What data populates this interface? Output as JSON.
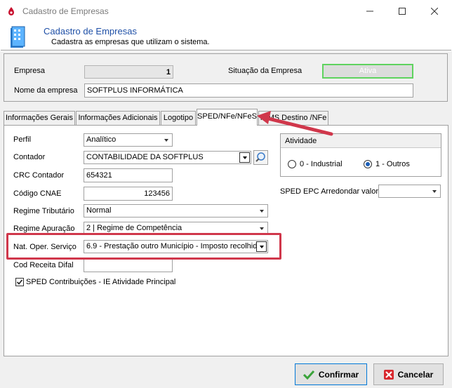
{
  "window": {
    "title": "Cadastro de Empresas"
  },
  "header": {
    "title": "Cadastro de Empresas",
    "subtitle": "Cadastra as empresas que utilizam o sistema."
  },
  "empresa": {
    "label_empresa": "Empresa",
    "empresa_value": "1",
    "label_situacao": "Situação da Empresa",
    "situacao_value": "Ativa",
    "label_nome": "Nome da empresa",
    "nome_value": "SOFTPLUS INFORMÁTICA"
  },
  "tabs": [
    {
      "label": "Informações Gerais"
    },
    {
      "label": "Informações Adicionais"
    },
    {
      "label": "Logotipo"
    },
    {
      "label": "SPED/NFe/NFeS"
    },
    {
      "label": "ICMS Destino /NFe"
    }
  ],
  "sped": {
    "perfil_label": "Perfil",
    "perfil_value": "Analítico",
    "contador_label": "Contador",
    "contador_value": "CONTABILIDADE DA SOFTPLUS",
    "crc_label": "CRC Contador",
    "crc_value": "654321",
    "cnae_label": "Código CNAE",
    "cnae_value": "123456",
    "regime_trib_label": "Regime Tributário",
    "regime_trib_value": "Normal",
    "regime_apur_label": "Regime Apuração",
    "regime_apur_value": "2 | Regime de Competência",
    "nat_oper_label": "Nat. Oper. Serviço",
    "nat_oper_value": "6.9 - Prestação outro Município - Imposto recolhid",
    "cod_receita_label": "Cod Receita Difal",
    "cod_receita_value": "",
    "sped_contrib_label": "SPED Contribuições - IE Atividade Principal",
    "sped_contrib_checked": true,
    "atividade_title": "Atividade",
    "atividade_opt1": "0 - Industrial",
    "atividade_opt2": "1 - Outros",
    "atividade_selected": "1 - Outros",
    "arredondar_label": "SPED EPC Arredondar valor",
    "arredondar_value": ""
  },
  "footer": {
    "confirm_label": "Confirmar",
    "cancel_label": "Cancelar"
  },
  "colors": {
    "highlight": "#d0374b",
    "header_title": "#1e4fa6",
    "ativa_border": "#5fd35f"
  }
}
